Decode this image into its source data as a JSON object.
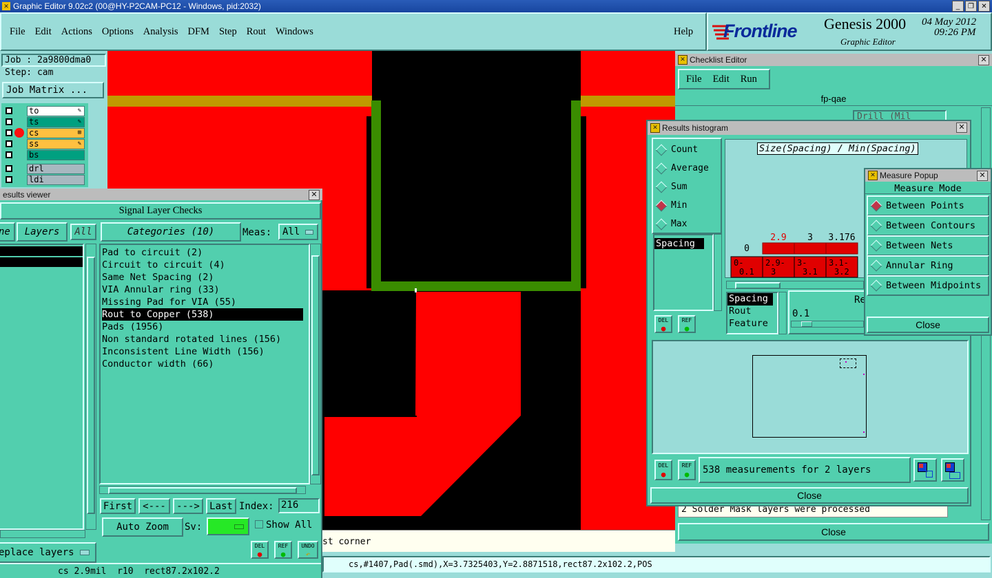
{
  "window": {
    "title": "Graphic Editor 9.02c2 (00@HY-P2CAM-PC12 - Windows, pid:2032)",
    "controls": [
      "_",
      "❐",
      "✕"
    ]
  },
  "menu": [
    "File",
    "Edit",
    "Actions",
    "Options",
    "Analysis",
    "DFM",
    "Step",
    "Rout",
    "Windows"
  ],
  "help": "Help",
  "brand": {
    "logo": "Frontline",
    "product": "Genesis 2000",
    "subtitle": "Graphic Editor",
    "date": "04 May 2012",
    "time": "09:26 PM"
  },
  "job": {
    "job_label": "Job : 2a9800dma0",
    "step_label": "Step: cam",
    "matrix_button": "Job Matrix ..."
  },
  "layers": [
    {
      "name": "to",
      "color": "#ffffff",
      "symbol": "✎"
    },
    {
      "name": "ts",
      "color": "#00a080",
      "symbol": "✎"
    },
    {
      "name": "cs",
      "color": "#ffc040",
      "symbol": "⊞",
      "active": true
    },
    {
      "name": "ss",
      "color": "#ffc040",
      "symbol": "✎"
    },
    {
      "name": "bs",
      "color": "#00a080",
      "symbol": ""
    },
    {
      "name": "drl",
      "color": "#a8b8c0",
      "symbol": ""
    },
    {
      "name": "ldi",
      "color": "#a8b8c0",
      "symbol": ""
    }
  ],
  "results_viewer": {
    "title": "esults viewer",
    "header": "Signal Layer Checks",
    "tab_left": "ne",
    "tab_layers": "Layers",
    "tab_all": "All",
    "categories_label": "Categories (10)",
    "meas_label": "Meas:",
    "meas_value": "All",
    "categories": [
      "Pad to circuit (2)",
      "Circuit to circuit (4)",
      "Same Net Spacing (2)",
      "VIA Annular ring (33)",
      "Missing Pad for VIA (55)",
      "Rout to Copper (538)",
      "Pads (1956)",
      "Non standard rotated lines (156)",
      "Inconsistent Line Width (156)",
      "Conductor width (66)"
    ],
    "selected_category": 5,
    "nav": {
      "first": "First",
      "prev": "<---",
      "next": "--->",
      "last": "Last",
      "index_label": "Index:",
      "index_value": "216"
    },
    "auto_zoom": "Auto Zoom",
    "sv_label": "Sv:",
    "show_all": "Show All",
    "replace": "eplace layers",
    "icons": {
      "del": "DEL",
      "ref": "REF",
      "undo": "UNDO"
    }
  },
  "status": {
    "left": "cs 2.9mil  r10  rect87.2x102.2",
    "message_left": "st corner",
    "coords": "cs,#1407,Pad(.smd),X=3.7325403,Y=2.8871518,rect87.2x102.2,POS"
  },
  "checklist": {
    "title": "Checklist Editor",
    "menu": [
      "File",
      "Edit",
      "Run"
    ],
    "name": "fp-qae",
    "row_text": "Drill (Mil",
    "message": "2 Solder Mask layers were processed",
    "close": "Close"
  },
  "histogram": {
    "title": "Results histogram",
    "modes": [
      "Count",
      "Average",
      "Sum",
      "Min",
      "Max"
    ],
    "selected_mode": "Min",
    "chart_title": "Size(Spacing) / Min(Spacing)",
    "list": [
      "Spacing"
    ],
    "list2": [
      "Spacing",
      "Rout",
      "Feature"
    ],
    "res_label": "Res",
    "slider_value": "0.1",
    "bin_values": [
      "0",
      "2.9",
      "3",
      "3.176"
    ],
    "bin_labels": [
      [
        "0-",
        "0.1"
      ],
      [
        "2.9-",
        "3"
      ],
      [
        "3-",
        "3.1"
      ],
      [
        "3.1-",
        "3.2"
      ]
    ],
    "measurements": "538 measurements for 2 layers",
    "close": "Close"
  },
  "chart_data": {
    "type": "bar",
    "title": "Size(Spacing) / Min(Spacing)",
    "categories": [
      "0-0.1",
      "2.9-3",
      "3-3.1",
      "3.1-3.2"
    ],
    "values": [
      0,
      2.9,
      3,
      3.176
    ],
    "highlight": "#e00000"
  },
  "measure": {
    "title": "Measure Popup",
    "header": "Measure Mode",
    "modes": [
      "Between Points",
      "Between Contours",
      "Between Nets",
      "Annular Ring",
      "Between Midpoints"
    ],
    "selected": "Between Points",
    "close": "Close"
  },
  "colors": {
    "panel": "#52cfae",
    "background": "#9adcd8",
    "copper": "#ff0000",
    "rout": "#3a8c00",
    "gold": "#c09a00"
  }
}
